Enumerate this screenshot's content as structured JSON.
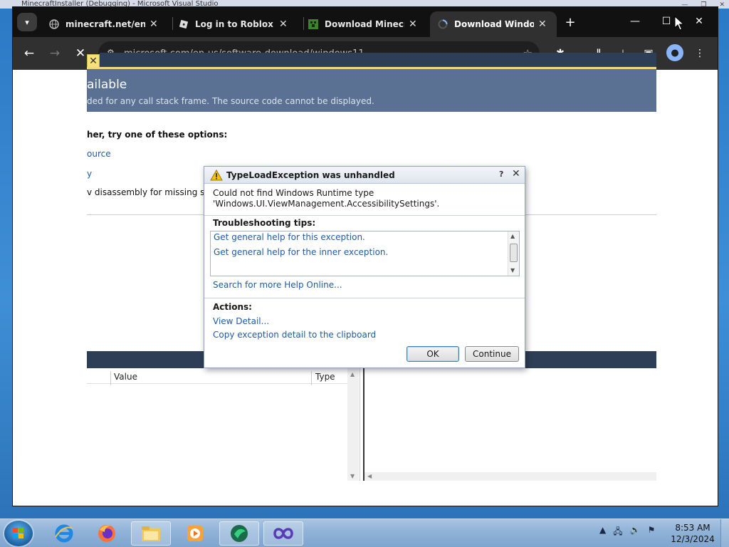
{
  "vs_window": {
    "title": "MinecraftInstaller (Debugging) - Microsoft Visual Studio"
  },
  "browser": {
    "tabs": [
      {
        "title": "minecraft.net/en-us/",
        "icon": "globe-icon",
        "active": false
      },
      {
        "title": "Log in to Roblox",
        "icon": "roblox-icon",
        "active": false
      },
      {
        "title": "Download Minecraft",
        "icon": "minecraft-icon",
        "active": false
      },
      {
        "title": "Download Windows",
        "icon": "loading-icon",
        "active": true
      }
    ],
    "url": "microsoft.com/en-us/software-download/windows11"
  },
  "vs": {
    "source_title": "ailable",
    "source_desc": "ded for any call stack frame. The source code cannot be displayed.",
    "options_heading": "her, try one of these options:",
    "options": [
      "ource",
      "y",
      "v disassembly for missing source"
    ],
    "locals_columns": [
      "Value",
      "Type"
    ]
  },
  "dialog": {
    "title": "TypeLoadException was unhandled",
    "help": "?",
    "message_line1": "Could not find Windows Runtime type",
    "message_line2": "'Windows.UI.ViewManagement.AccessibilitySettings'.",
    "tips_heading": "Troubleshooting tips:",
    "tips": [
      "Get general help for this exception.",
      "Get general help for the inner exception."
    ],
    "search_link": "Search for more Help Online...",
    "actions_heading": "Actions:",
    "actions": [
      "View Detail...",
      "Copy exception detail to the clipboard"
    ],
    "ok_label": "OK",
    "continue_label": "Continue"
  },
  "taskbar": {
    "pinned": [
      "internet-explorer-icon",
      "firefox-icon",
      "file-explorer-icon",
      "media-player-icon",
      "app-icon",
      "visual-studio-icon"
    ],
    "time": "8:53 AM",
    "date": "12/3/2024"
  }
}
